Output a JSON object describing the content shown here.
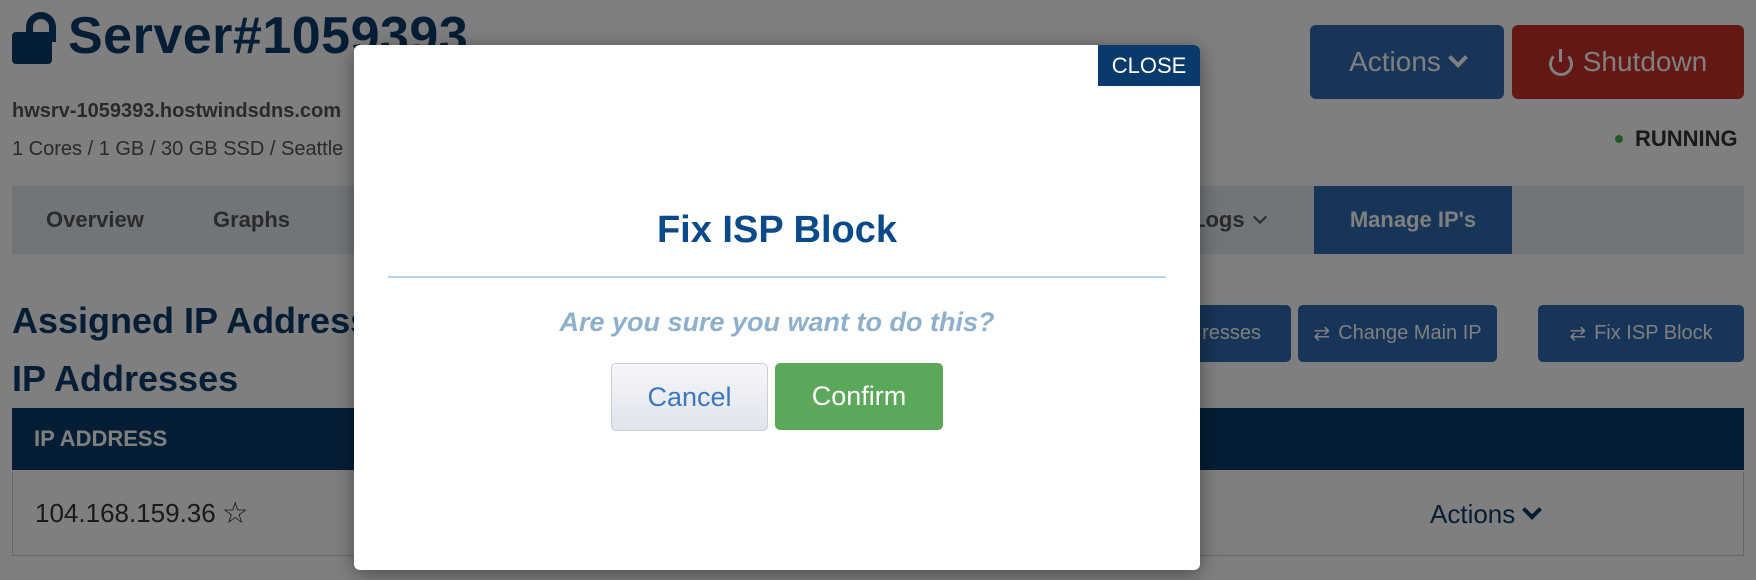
{
  "server": {
    "title": "Server#1059393",
    "hostname": "hwsrv-1059393.hostwindsdns.com",
    "specs": "1 Cores / 1 GB / 30 GB SSD / Seattle",
    "status": "RUNNING"
  },
  "header_buttons": {
    "actions_label": "Actions",
    "shutdown_label": "Shutdown"
  },
  "tabs": [
    {
      "label": "Overview"
    },
    {
      "label": "Graphs"
    },
    {
      "label": "Logs"
    },
    {
      "label": "Manage IP's",
      "active": true
    }
  ],
  "section": {
    "assigned_heading": "Assigned IP Addresses",
    "ips_heading": "IP Addresses"
  },
  "ip_buttons": {
    "addresses_partial": "resses",
    "change_main_ip": "Change Main IP",
    "fix_isp_block": "Fix ISP Block"
  },
  "table": {
    "header": "IP ADDRESS",
    "rows": [
      {
        "ip": "104.168.159.36",
        "actions_label": "Actions"
      }
    ]
  },
  "modal": {
    "close_label": "CLOSE",
    "title": "Fix ISP Block",
    "question": "Are you sure you want to do this?",
    "cancel_label": "Cancel",
    "confirm_label": "Confirm"
  },
  "colors": {
    "brand_dark": "#0a3a6b",
    "primary": "#2c6bb0",
    "danger": "#c9302c",
    "success": "#5ca85a",
    "status_running": "#4cae4c"
  }
}
